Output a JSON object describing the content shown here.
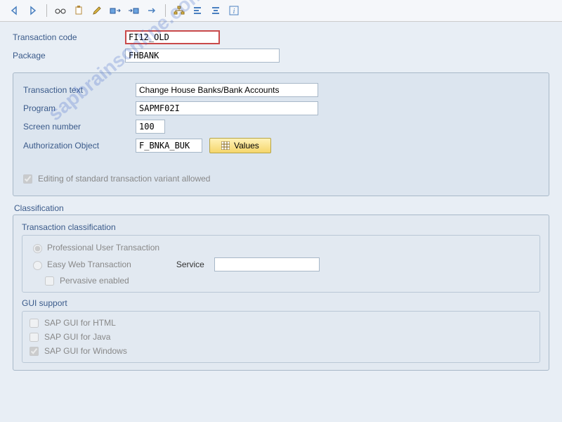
{
  "toolbar": {
    "icons": [
      "back",
      "forward",
      "glasses",
      "clipboard",
      "pencil",
      "transport1",
      "transport2",
      "arrow",
      "hierarchy",
      "alignleft",
      "aligncenter",
      "info"
    ]
  },
  "header": {
    "tx_label": "Transaction code",
    "tx_value": "FI12_OLD",
    "pkg_label": "Package",
    "pkg_value": "FHBANK"
  },
  "details": {
    "txtext_label": "Transaction text",
    "txtext_value": "Change House Banks/Bank Accounts",
    "prog_label": "Program",
    "prog_value": "SAPMF02I",
    "scr_label": "Screen number",
    "scr_value": "100",
    "auth_label": "Authorization Object",
    "auth_value": "F_BNKA_BUK",
    "values_btn": "Values",
    "edit_variant": "Editing of standard transaction variant allowed"
  },
  "classification": {
    "title": "Classification",
    "txclass_title": "Transaction classification",
    "prof": "Professional User Transaction",
    "easy": "Easy Web Transaction",
    "service_label": "Service",
    "pervasive": "Pervasive enabled",
    "gui_title": "GUI support",
    "gui_html": "SAP GUI for HTML",
    "gui_java": "SAP GUI for Java",
    "gui_win": "SAP GUI for Windows"
  },
  "watermark": "sapbrainsonline.com"
}
